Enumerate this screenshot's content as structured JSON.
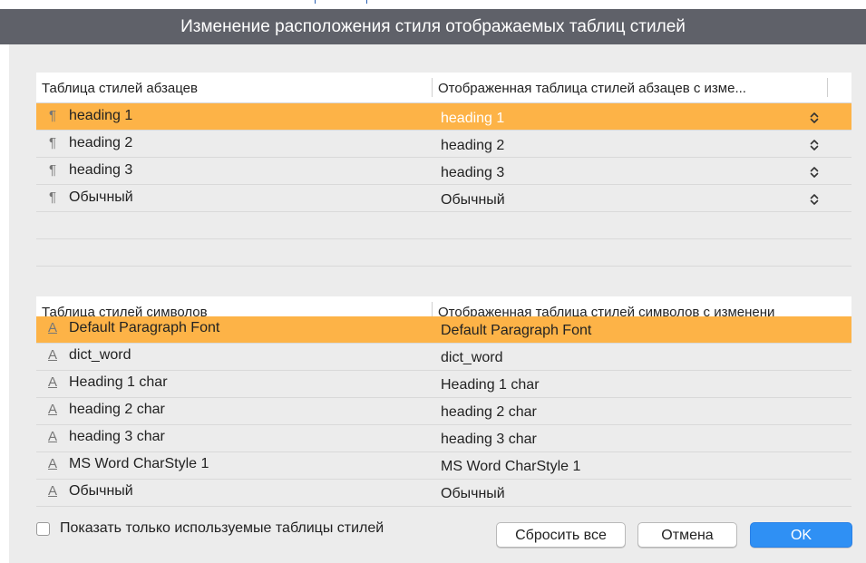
{
  "window": {
    "title": "Изменение расположения стиля отображаемых таблиц стилей"
  },
  "colors": {
    "selection": "#fdb347",
    "accent": "#2f90f4",
    "titlebar": "#5f6169"
  },
  "paragraph_table": {
    "col1": "Таблица стилей абзацев",
    "col2": "Отображенная таблица стилей абзацев с изме...",
    "rows": [
      {
        "name": "heading 1",
        "mapped": "heading 1",
        "icon": "paragraph-icon",
        "selected": true
      },
      {
        "name": "heading 2",
        "mapped": "heading 2",
        "icon": "paragraph-icon"
      },
      {
        "name": "heading 3",
        "mapped": "heading 3",
        "icon": "paragraph-icon"
      },
      {
        "name": "Обычный",
        "mapped": "Обычный",
        "icon": "paragraph-icon"
      }
    ]
  },
  "character_table": {
    "col1": "Таблица стилей символов",
    "col2": "Отображенная таблица стилей символов с изменени",
    "rows": [
      {
        "name": "Default Paragraph Font",
        "mapped": "Default Paragraph Font",
        "icon": "character-icon",
        "selected": true
      },
      {
        "name": "dict_word",
        "mapped": "dict_word",
        "icon": "character-icon"
      },
      {
        "name": "Heading 1 char",
        "mapped": "Heading 1 char",
        "icon": "character-icon"
      },
      {
        "name": "heading 2 char",
        "mapped": "heading 2 char",
        "icon": "character-icon"
      },
      {
        "name": "heading 3 char",
        "mapped": "heading 3 char",
        "icon": "character-icon"
      },
      {
        "name": "MS Word CharStyle 1",
        "mapped": "MS Word CharStyle 1",
        "icon": "character-icon"
      },
      {
        "name": "Обычный",
        "mapped": "Обычный",
        "icon": "character-icon"
      }
    ]
  },
  "footer": {
    "checkbox_label": "Показать только используемые таблицы стилей",
    "checkbox_checked": false,
    "reset_label": "Сбросить все",
    "cancel_label": "Отмена",
    "ok_label": "OK"
  }
}
